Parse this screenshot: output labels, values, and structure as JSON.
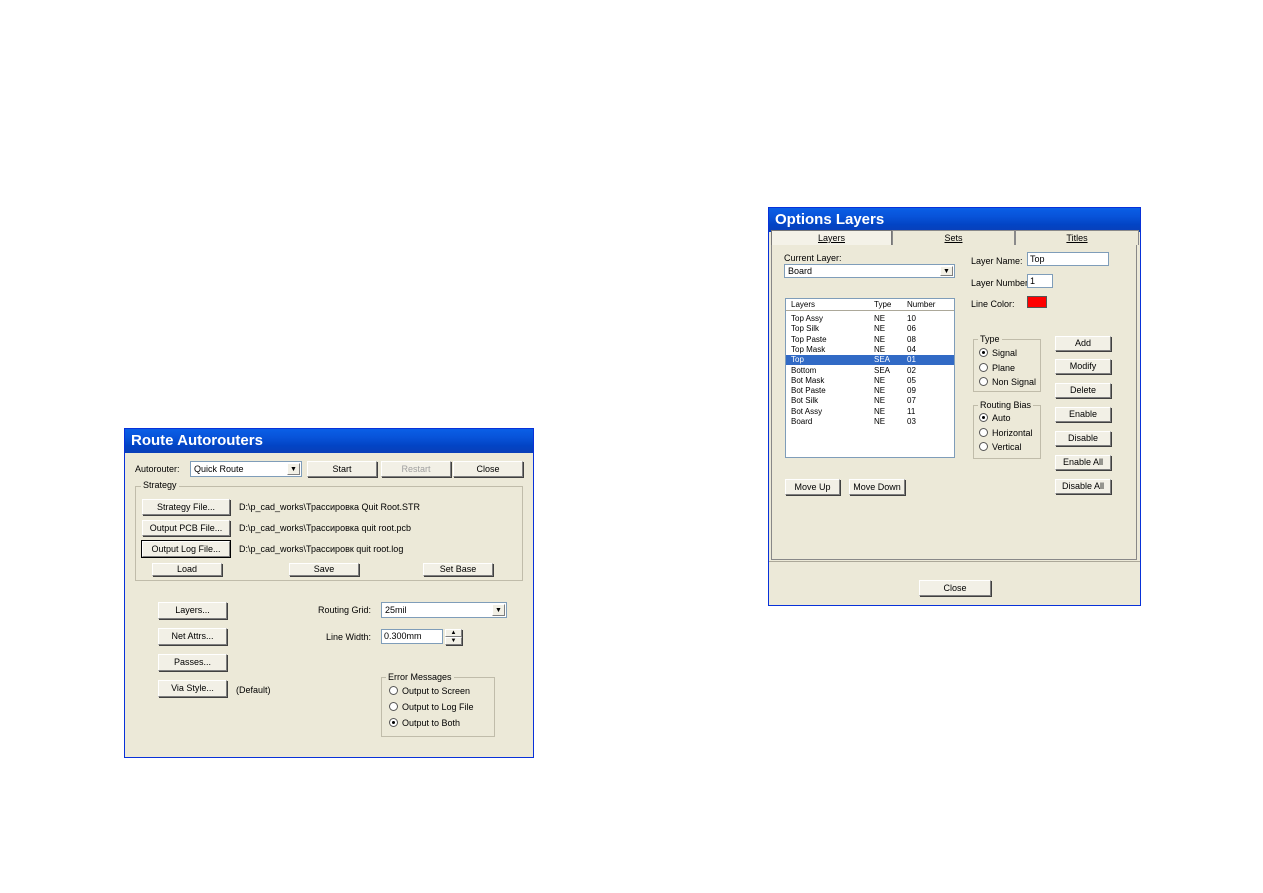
{
  "route": {
    "title": "Route Autorouters",
    "autorouter_label": "Autorouter:",
    "autorouter_value": "Quick Route",
    "start": "Start",
    "restart": "Restart",
    "close": "Close",
    "strategy_label": "Strategy",
    "strategy_file_btn": "Strategy File...",
    "strategy_file_path": "D:\\p_cad_works\\Трассировка Quit Root.STR",
    "output_pcb_btn": "Output PCB File...",
    "output_pcb_path": "D:\\p_cad_works\\Трассировка quit root.pcb",
    "output_log_btn": "Output Log File...",
    "output_log_path": "D:\\p_cad_works\\Трассировк quit root.log",
    "load": "Load",
    "save": "Save",
    "set_base": "Set Base",
    "layers_btn": "Layers...",
    "net_attrs_btn": "Net Attrs...",
    "passes_btn": "Passes...",
    "via_style_btn": "Via Style...",
    "via_style_value": "(Default)",
    "routing_grid_label": "Routing Grid:",
    "routing_grid_value": "25mil",
    "line_width_label": "Line Width:",
    "line_width_value": "0.300mm",
    "error_messages_label": "Error Messages",
    "error_options": [
      "Output to Screen",
      "Output to Log File",
      "Output to Both"
    ],
    "error_selected": 2
  },
  "layers": {
    "title": "Options Layers",
    "tabs": [
      "Layers",
      "Sets",
      "Titles"
    ],
    "current_layer_label": "Current Layer:",
    "current_layer_value": "Board",
    "col_layers": "Layers",
    "col_type": "Type",
    "col_number": "Number",
    "rows": [
      {
        "name": "Top Assy",
        "type": "NE",
        "num": "10"
      },
      {
        "name": "Top Silk",
        "type": "NE",
        "num": "06"
      },
      {
        "name": "Top Paste",
        "type": "NE",
        "num": "08"
      },
      {
        "name": "Top Mask",
        "type": "NE",
        "num": "04"
      },
      {
        "name": "Top",
        "type": "SEA",
        "num": "01"
      },
      {
        "name": "Bottom",
        "type": "SEA",
        "num": "02"
      },
      {
        "name": "Bot Mask",
        "type": "NE",
        "num": "05"
      },
      {
        "name": "Bot Paste",
        "type": "NE",
        "num": "09"
      },
      {
        "name": "Bot Silk",
        "type": "NE",
        "num": "07"
      },
      {
        "name": "Bot Assy",
        "type": "NE",
        "num": "11"
      },
      {
        "name": "Board",
        "type": "NE",
        "num": "03"
      }
    ],
    "selected_row": 4,
    "layer_name_label": "Layer Name:",
    "layer_name_value": "Top",
    "layer_number_label": "Layer Number:",
    "layer_number_value": "1",
    "line_color_label": "Line Color:",
    "line_color": "#ff0000",
    "type_label": "Type",
    "type_options": [
      "Signal",
      "Plane",
      "Non Signal"
    ],
    "type_selected": 0,
    "bias_label": "Routing Bias",
    "bias_options": [
      "Auto",
      "Horizontal",
      "Vertical"
    ],
    "bias_selected": 0,
    "add": "Add",
    "modify": "Modify",
    "delete": "Delete",
    "enable": "Enable",
    "disable": "Disable",
    "enable_all": "Enable All",
    "disable_all": "Disable All",
    "move_up": "Move Up",
    "move_down": "Move Down",
    "close": "Close"
  }
}
